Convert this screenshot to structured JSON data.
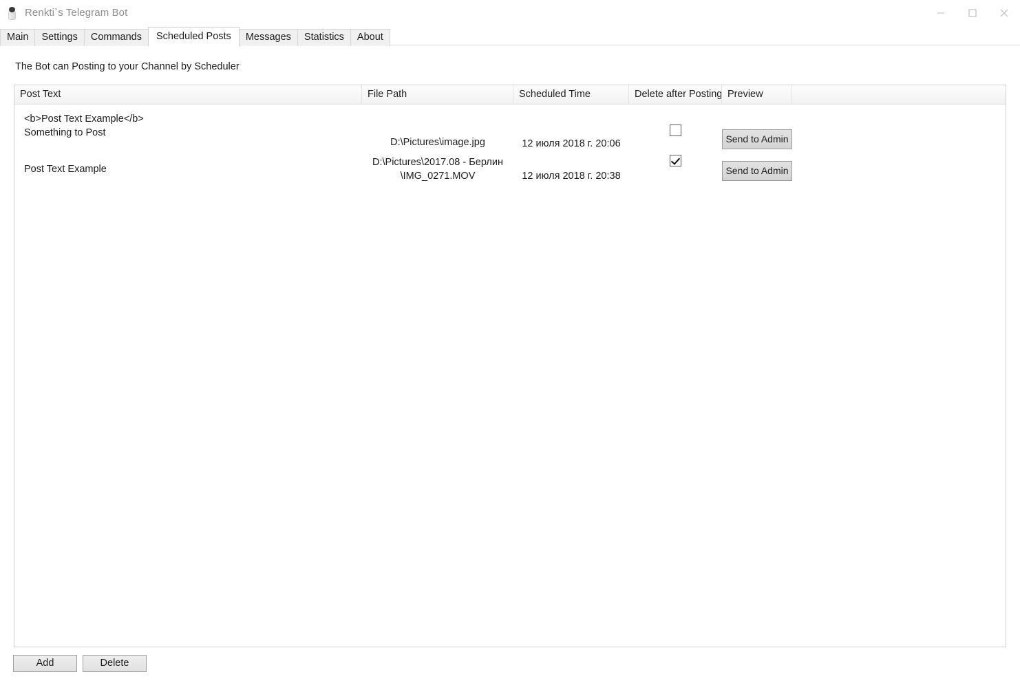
{
  "window": {
    "title": "Renkti`s Telegram Bot",
    "icon": "bot-icon",
    "controls": {
      "minimize": "minimize-icon",
      "maximize": "maximize-icon",
      "close": "close-icon"
    }
  },
  "tabs": [
    {
      "label": "Main",
      "selected": false
    },
    {
      "label": "Settings",
      "selected": false
    },
    {
      "label": "Commands",
      "selected": false
    },
    {
      "label": "Scheduled Posts",
      "selected": true
    },
    {
      "label": "Messages",
      "selected": false
    },
    {
      "label": "Statistics",
      "selected": false
    },
    {
      "label": "About",
      "selected": false
    }
  ],
  "main": {
    "hint": "The Bot can Posting to your Channel by Scheduler",
    "grid": {
      "columns": [
        "Post Text",
        "File Path",
        "Scheduled Time",
        "Delete after Posting",
        "Preview"
      ],
      "rows": [
        {
          "post_text_line1": "<b>Post Text Example</b>",
          "post_text_line2": "Something to Post",
          "file_path_line1": "D:\\Pictures\\image.jpg",
          "file_path_line2": "",
          "scheduled_time": "12 июля 2018 г. 20:06",
          "delete_after_posting": false,
          "preview_label": "Send to Admin"
        },
        {
          "post_text_line1": "Post Text Example",
          "post_text_line2": "",
          "file_path_line1": "D:\\Pictures\\2017.08 - Берлин",
          "file_path_line2": "\\IMG_0271.MOV",
          "scheduled_time": "12 июля 2018 г. 20:38",
          "delete_after_posting": true,
          "preview_label": "Send to Admin"
        }
      ]
    }
  },
  "footer": {
    "add_label": "Add",
    "delete_label": "Delete"
  },
  "colors": {
    "window_bg": "#ffffff",
    "title_text": "#8e8e8e",
    "text": "#1d1d1d",
    "grid_border": "#d0d0d0",
    "header_bg": "#f5f5f5",
    "button_face": "#e0e0e0"
  }
}
